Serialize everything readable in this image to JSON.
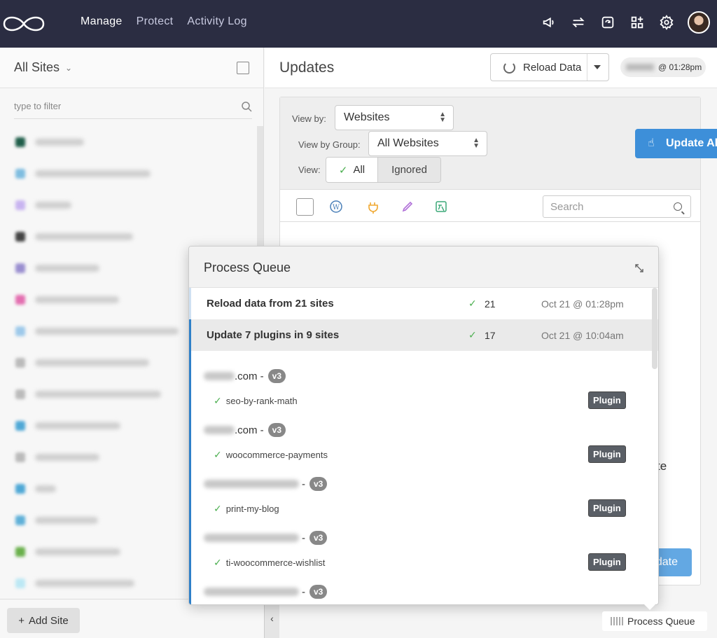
{
  "nav": {
    "items": [
      "Manage",
      "Protect",
      "Activity Log"
    ],
    "active": "Manage"
  },
  "top_icons": [
    "megaphone-icon",
    "sync-arrows-icon",
    "refresh-box-icon",
    "apps-add-icon",
    "gear-icon"
  ],
  "sidebar": {
    "title": "All Sites",
    "filter_placeholder": "type to filter",
    "add_site_label": "Add Site",
    "favicon_colors": [
      "#1f5e4a",
      "#7fbde0",
      "#c8b4f0",
      "#444444",
      "#9a8fd0",
      "#e36fb0",
      "#9ec9ea",
      "#bbbbbb",
      "#bbbbbb",
      "#4fa8d6",
      "#bbbbbb",
      "#4fa8d6",
      "#5fb0d8",
      "#6ab04c",
      "#bce8f4"
    ]
  },
  "main": {
    "title": "Updates",
    "reload_label": "Reload Data",
    "time_label": "@ 01:28pm",
    "view_by_label": "View by:",
    "view_by_value": "Websites",
    "view_group_label": "View by Group:",
    "view_group_value": "All Websites",
    "view_label": "View:",
    "view_all": "All",
    "view_ignored": "Ignored",
    "update_all_label": "Update Al",
    "search_placeholder": "Search",
    "peek_text": "te",
    "peek_button": "date"
  },
  "process_queue": {
    "title": "Process Queue",
    "rows": [
      {
        "message": "Reload data from 21 sites",
        "count": "21",
        "date": "Oct 21 @ 01:28pm"
      },
      {
        "message": "Update 7 plugins in 9 sites",
        "count": "17",
        "date": "Oct 21 @ 10:04am"
      }
    ],
    "items": [
      {
        "site_suffix": ".com -",
        "version": "v3",
        "plugin": "seo-by-rank-math",
        "tag": "Plugin"
      },
      {
        "site_suffix": ".com -",
        "version": "v3",
        "plugin": "woocommerce-payments",
        "tag": "Plugin"
      },
      {
        "site_suffix": "-",
        "version": "v3",
        "plugin": "print-my-blog",
        "tag": "Plugin"
      },
      {
        "site_suffix": "-",
        "version": "v3",
        "plugin": "ti-woocommerce-wishlist",
        "tag": "Plugin"
      },
      {
        "site_suffix": "-",
        "version": "v3"
      }
    ],
    "button_label": "Process Queue"
  },
  "colors": {
    "topbar": "#2b2d42",
    "accent": "#3d8fd9",
    "success": "#4caf50"
  }
}
